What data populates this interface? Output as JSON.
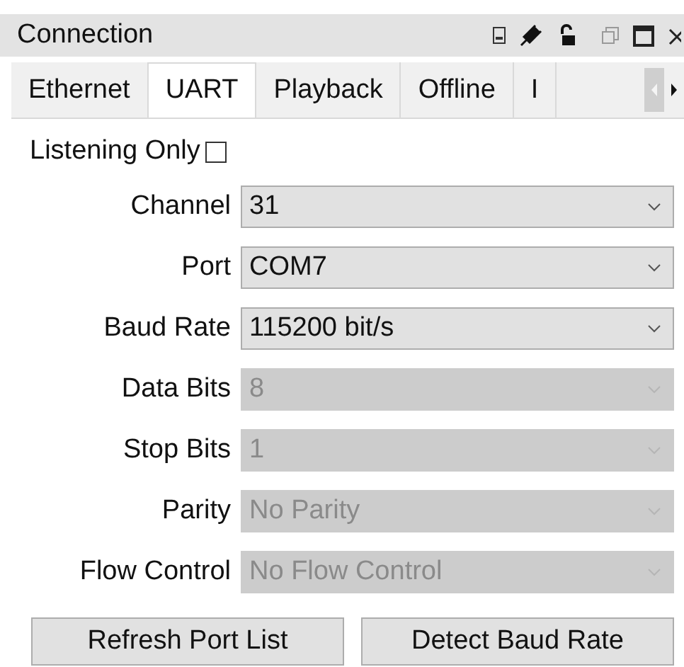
{
  "window": {
    "title": "Connection"
  },
  "tabs": [
    {
      "label": "Ethernet",
      "selected": false
    },
    {
      "label": "UART",
      "selected": true
    },
    {
      "label": "Playback",
      "selected": false
    },
    {
      "label": "Offline",
      "selected": false
    },
    {
      "label": "I",
      "selected": false
    }
  ],
  "listening_only": {
    "label": "Listening Only",
    "checked": false
  },
  "fields": [
    {
      "label": "Channel",
      "value": "31",
      "disabled": false
    },
    {
      "label": "Port",
      "value": "COM7",
      "disabled": false
    },
    {
      "label": "Baud Rate",
      "value": "115200 bit/s",
      "disabled": false
    },
    {
      "label": "Data Bits",
      "value": "8",
      "disabled": true
    },
    {
      "label": "Stop Bits",
      "value": "1",
      "disabled": true
    },
    {
      "label": "Parity",
      "value": "No Parity",
      "disabled": true
    },
    {
      "label": "Flow Control",
      "value": "No Flow Control",
      "disabled": true
    }
  ],
  "buttons": [
    "Refresh Port List",
    "Detect Baud Rate"
  ]
}
